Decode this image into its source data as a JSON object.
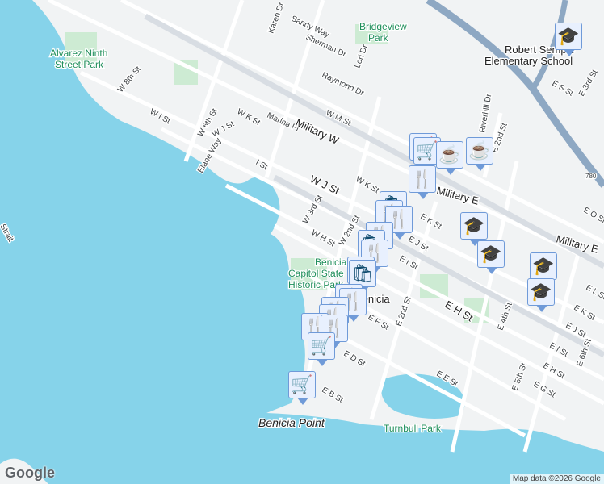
{
  "map": {
    "parks": [
      "Alvarez Ninth",
      "Street Park",
      "Bridgeview",
      "Park",
      "Benicia",
      "Capitol State",
      "Historic Park",
      "Turnbull Park"
    ],
    "places": [
      "Benicia",
      "Benicia Point",
      "Robert Semple",
      "Elementary School",
      "Strait",
      "780"
    ],
    "streets": [
      "W 8th St",
      "W I St",
      "W 6th St",
      "W J St",
      "Elane Way",
      "W K St",
      "Marina Pl",
      "I St",
      "Military W",
      "W M St",
      "Raymond Dr",
      "Sherman Dr",
      "Karen Dr",
      "Sandy Way",
      "Lori Dr",
      "W J St",
      "W 3rd St",
      "W K St",
      "W H St",
      "W 2nd St",
      "E K St",
      "E J St",
      "E I St",
      "Military E",
      "E H St",
      "E 2nd St",
      "E F St",
      "E D St",
      "E E St",
      "E B St",
      "E 4th St",
      "E 5th St",
      "E 6th St",
      "E I St",
      "E H St",
      "E G St",
      "E J St",
      "E K St",
      "E L St",
      "E O St",
      "E S St",
      "E 3rd St",
      "Riverhill Dr",
      "E 2nd St",
      "Military E"
    ]
  },
  "markers": [
    "school",
    "cart",
    "cart",
    "coffee",
    "coffee",
    "restaurant",
    "shopping",
    "restaurant",
    "restaurant",
    "school",
    "school",
    "restaurant",
    "shopping",
    "restaurant",
    "shopping",
    "shopping",
    "school",
    "school",
    "restaurant",
    "restaurant",
    "restaurant",
    "restaurant",
    "restaurant",
    "restaurant",
    "cart",
    "cart"
  ],
  "icons": {
    "school": "🎓",
    "cart": "🛒",
    "coffee": "☕",
    "restaurant": "🍴",
    "shopping": "🛍"
  },
  "footer": {
    "logo": "Google",
    "attribution": "Map data ©2026 Google"
  }
}
